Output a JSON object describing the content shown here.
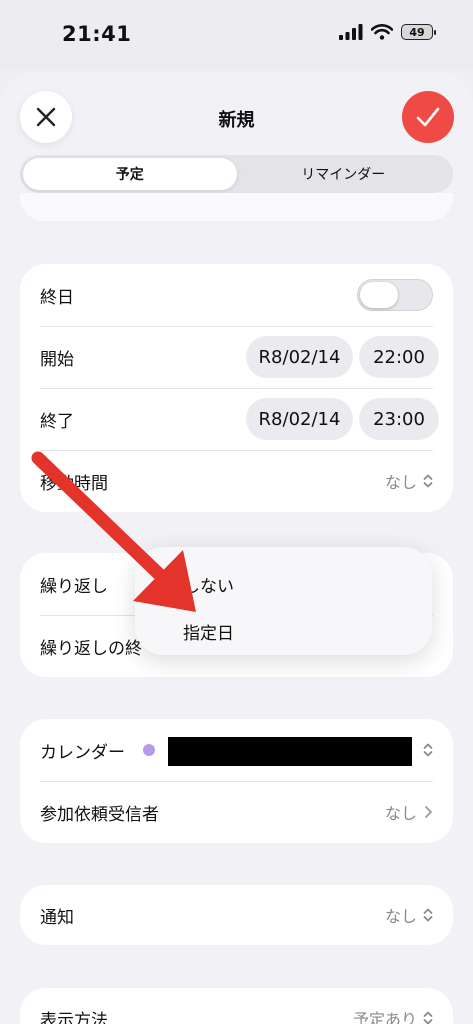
{
  "status_bar": {
    "time": "21:41",
    "battery": "49"
  },
  "header": {
    "title": "新規"
  },
  "segments": {
    "event": "予定",
    "reminder": "リマインダー"
  },
  "allday": {
    "label": "終日"
  },
  "start": {
    "label": "開始",
    "date": "R8/02/14",
    "time": "22:00"
  },
  "end": {
    "label": "終了",
    "date": "R8/02/14",
    "time": "23:00"
  },
  "travel": {
    "label": "移動時間",
    "value": "なし"
  },
  "repeat": {
    "label": "繰り返し",
    "end_label": "繰り返しの終"
  },
  "repeat_menu": {
    "options": [
      "しない",
      "指定日"
    ]
  },
  "calendar": {
    "label": "カレンダー",
    "color": "#b79ae9"
  },
  "invitees": {
    "label": "参加依頼受信者",
    "value": "なし"
  },
  "alert": {
    "label": "通知",
    "value": "なし"
  },
  "show_as": {
    "label": "表示方法",
    "value": "予定あり"
  },
  "colors": {
    "accent": "#ef4a45",
    "annotation_arrow": "#e3332b"
  }
}
